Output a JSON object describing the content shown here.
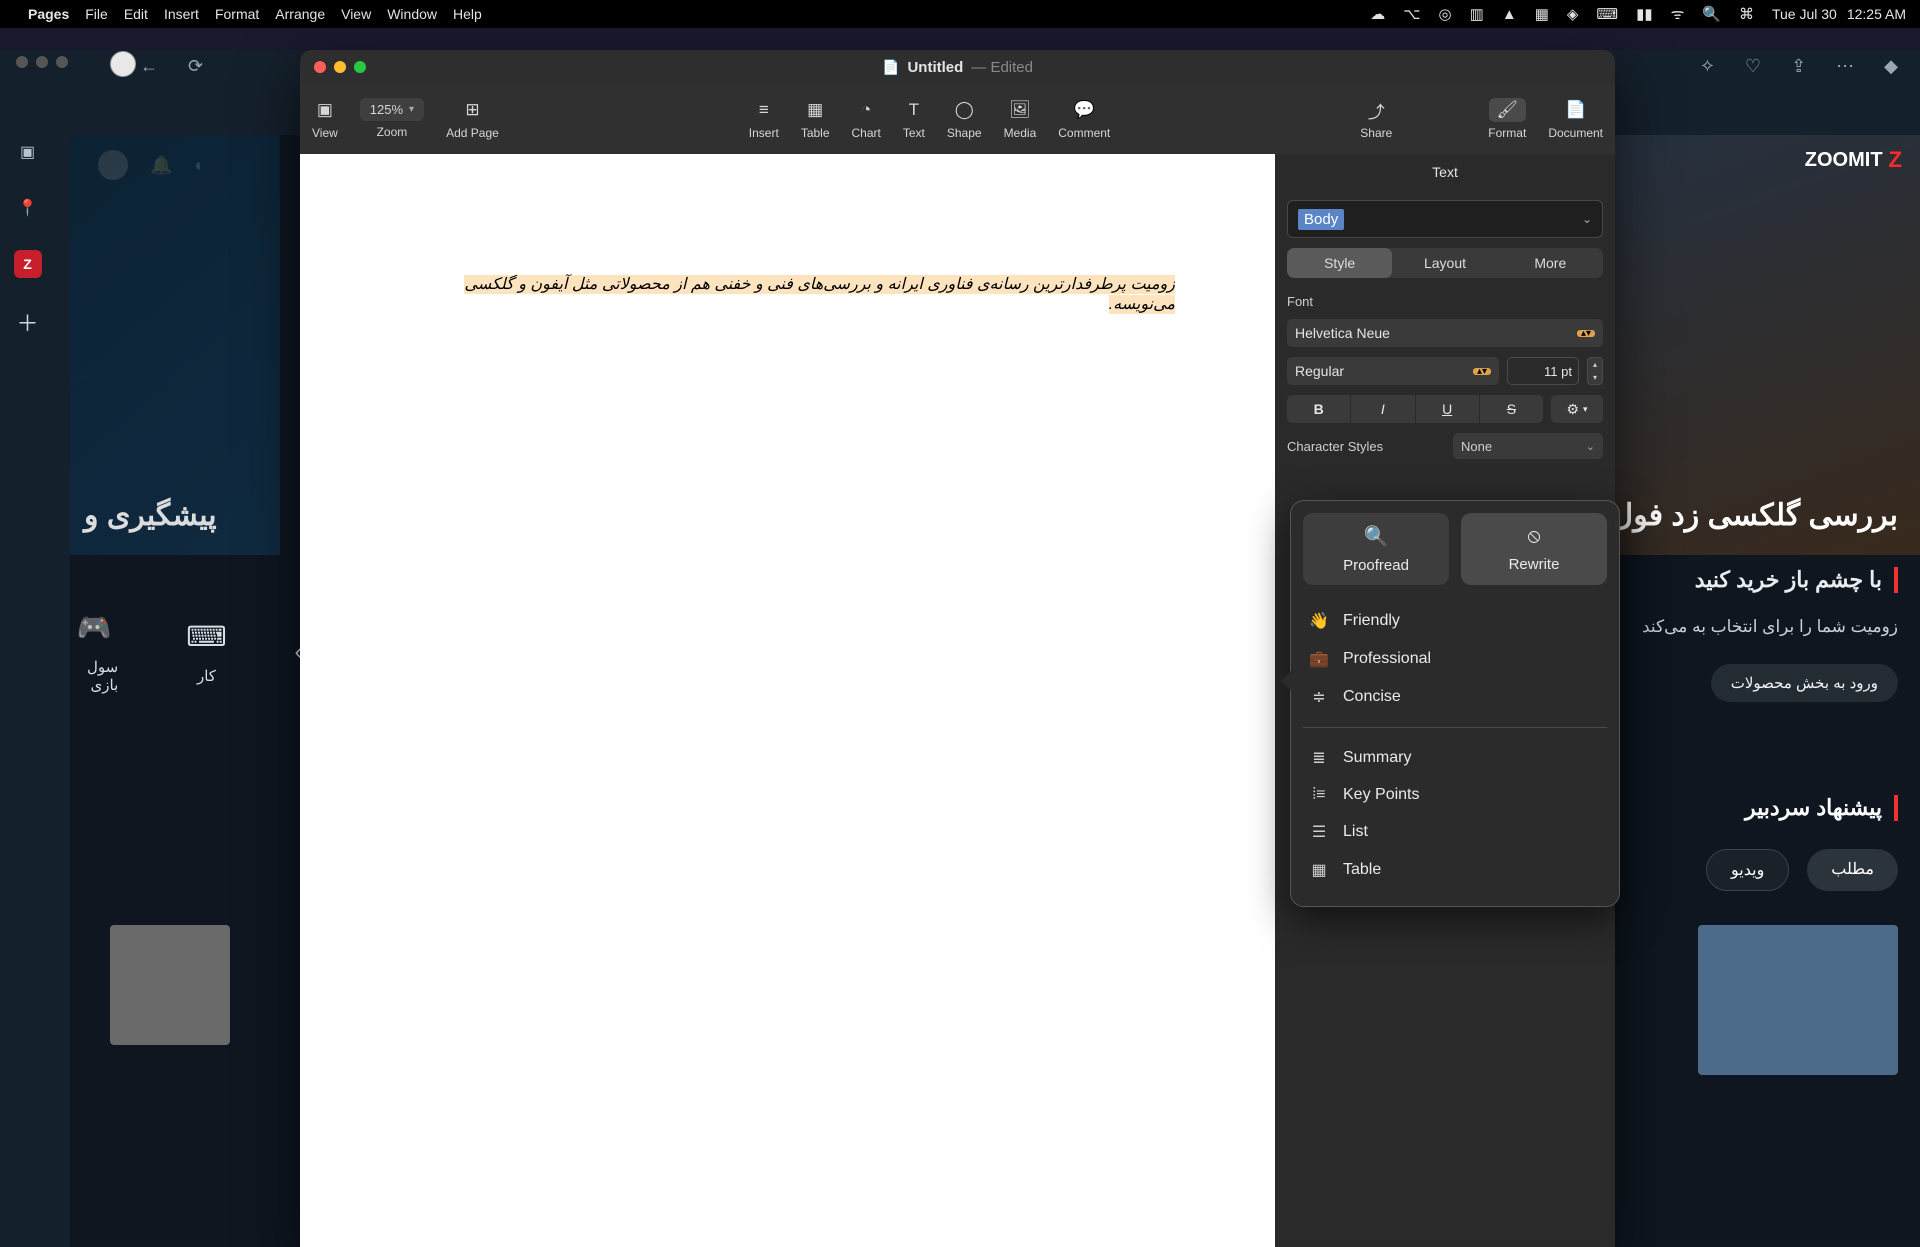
{
  "menubar": {
    "app": "Pages",
    "items": [
      "File",
      "Edit",
      "Insert",
      "Format",
      "Arrange",
      "View",
      "Window",
      "Help"
    ],
    "datetime": {
      "date": "Tue Jul 30",
      "time": "12:25 AM"
    }
  },
  "browser": {
    "logo_text": "ZOOMIT",
    "left_hero": "پیشگیری و",
    "right_hero": "بررسی گلکسی زد فول",
    "buy": {
      "heading": "با چشم باز خرید کنید",
      "desc": "زومیت شما را برای انتخاب به می‌کند",
      "button": "ورود به بخش محصولات"
    },
    "editor_pick": {
      "heading": "پیشنهاد سردبیر",
      "chips": [
        "مطلب",
        "ویدیو"
      ]
    },
    "categories": [
      {
        "icon": "🎮",
        "label": "سول بازی"
      },
      {
        "icon": "⌨",
        "label": "کار"
      }
    ]
  },
  "pages": {
    "doc_title": "Untitled",
    "edited": "— Edited",
    "toolbar": {
      "view": "View",
      "zoom": "Zoom",
      "zoom_value": "125%",
      "add_page": "Add Page",
      "insert": "Insert",
      "table": "Table",
      "chart": "Chart",
      "text": "Text",
      "shape": "Shape",
      "media": "Media",
      "comment": "Comment",
      "share": "Share",
      "format": "Format",
      "document": "Document"
    },
    "body_text": "زومیت پرطرفدارترین رسانه‌ی فناوری ایرانه و بررسی‌های فنی و خفنی هم از محصولاتی مثل آیفون و گلکسی می‌نویسه.",
    "inspector": {
      "title": "Text",
      "paragraph_style": "Body",
      "tabs": [
        "Style",
        "Layout",
        "More"
      ],
      "font_label": "Font",
      "font_family": "Helvetica Neue",
      "font_weight": "Regular",
      "font_size": "11 pt",
      "char_styles_label": "Character Styles",
      "char_styles_value": "None"
    }
  },
  "writing_tools": {
    "proofread": "Proofread",
    "rewrite": "Rewrite",
    "group1": [
      "Friendly",
      "Professional",
      "Concise"
    ],
    "group2": [
      "Summary",
      "Key Points",
      "List",
      "Table"
    ]
  }
}
